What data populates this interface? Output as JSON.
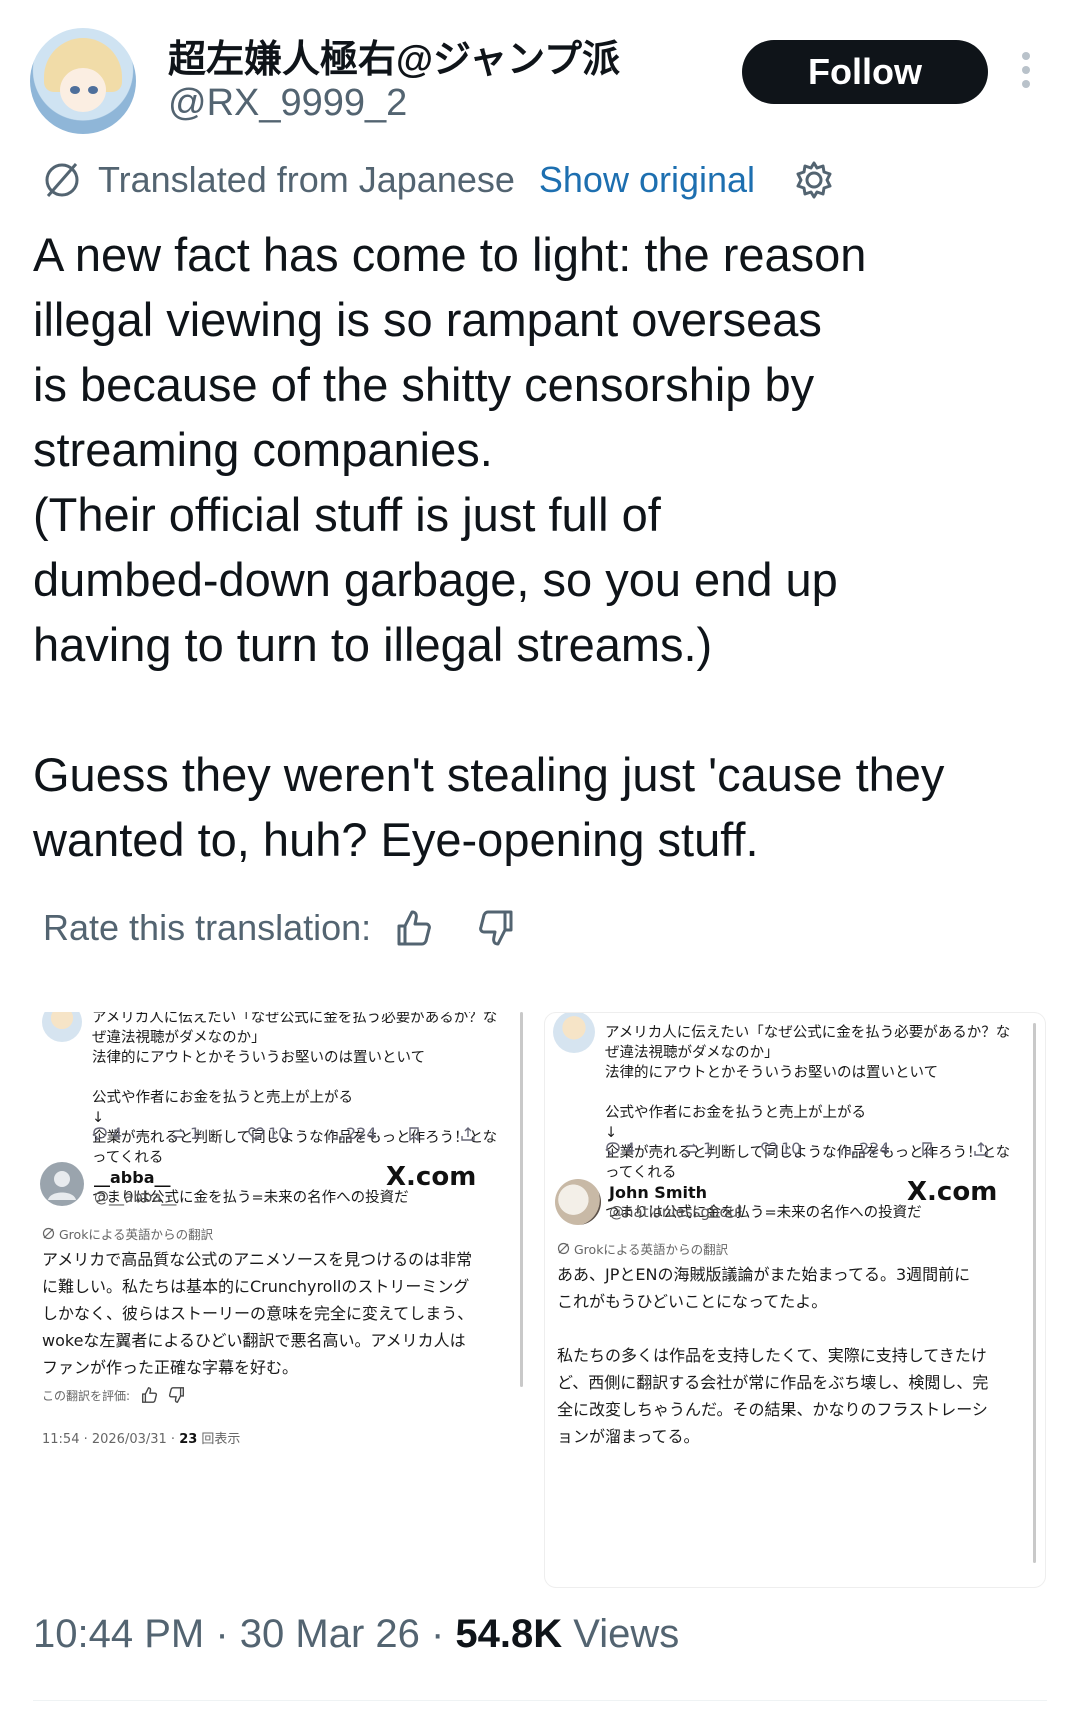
{
  "author": {
    "display_name": "超左嫌人極右@ジャンプ派",
    "handle": "@RX_9999_2",
    "follow_label": "Follow"
  },
  "translation_bar": {
    "translated_label": "Translated from Japanese",
    "show_original_label": "Show original"
  },
  "tweet": {
    "text": "A new fact has come to light: the reason\nillegal viewing is so rampant overseas\nis because of the shitty censorship by\nstreaming companies.\n(Their official stuff is just full of\ndumbed-down garbage, so you end up\nhaving to turn to illegal streams.)\n\nGuess they weren't stealing just 'cause they\nwanted to, huh? Eye-opening stuff."
  },
  "rate": {
    "label": "Rate this translation:"
  },
  "screenshots": [
    {
      "jp_text": "アメリカ人に伝えたい「なぜ公式に金を払う必要があるか？な\nぜ違法視聴がダメなのか」\n法律的にアウトとかそういうお堅いのは置いといて\n\n公式や作者にお金を払うと売上が上がる\n↓\n企業が売れると判断して同じような作品をもっと作ろう！とな\nってくれる\n\nつまりは公式に金を払う=未来の名作への投資だ",
      "stats": {
        "replies": "4",
        "reposts": "1",
        "likes": "10",
        "views": "224"
      },
      "reply_name": "__abba__",
      "reply_handle": "@__abba__",
      "source": "X.com",
      "grok_label": "Grokによる英語からの翻訳",
      "reply_text": "アメリカで高品質な公式のアニメソースを見つけるのは非常\nに難しい。私たちは基本的にCrunchyrollのストリーミング\nしかなく、彼らはストーリーの意味を完全に変えてしまう、\nwokeな左翼者によるひどい翻訳で悪名高い。アメリカ人は\nファンが作った正確な字幕を好む。",
      "rate_label": "この翻訳を評価:",
      "meta_time": "11:54 · 2026/03/31 · ",
      "meta_views": "23",
      "meta_views_label": " 回表示"
    },
    {
      "jp_text": "アメリカ人に伝えたい「なぜ公式に金を払う必要があるか？な\nぜ違法視聴がダメなのか」\n法律的にアウトとかそういうお堅いのは置いといて\n\n公式や作者にお金を払うと売上が上がる\n↓\n企業が売れると判断して同じような作品をもっと作ろう！とな\nってくれる\n\nつまりは公式に金を払う=未来の名作への投資だ",
      "stats": {
        "replies": "4",
        "reposts": "1",
        "likes": "10",
        "views": "224"
      },
      "reply_name": "John Smith",
      "reply_handle": "@nationlessghoul",
      "source": "X.com",
      "grok_label": "Grokによる英語からの翻訳",
      "reply_text": "ああ、JPとENの海賊版議論がまた始まってる。3週間前に\nこれがもうひどいことになってたよ。\n\n私たちの多くは作品を支持したくて、実際に支持してきたけ\nど、西側に翻訳する会社が常に作品をぶち壊し、検閲し、完\n全に改変しちゃうんだ。その結果、かなりのフラストレーシ\nョンが溜まってる。"
    }
  ],
  "footer": {
    "time": "10:44 PM",
    "sep1": " · ",
    "date": "30 Mar 26",
    "sep2": " · ",
    "views_count": "54.8K",
    "views_label": " Views"
  },
  "colors": {
    "text": "#0f1419",
    "secondary": "#536471",
    "link": "#1d6fb0",
    "follow_bg": "#0f1419"
  },
  "icons": [
    "globe-translate-icon",
    "gear-icon",
    "thumbs-up-icon",
    "thumbs-down-icon",
    "more-icon",
    "reply-icon",
    "repost-icon",
    "like-icon",
    "views-icon",
    "bookmark-icon",
    "share-icon"
  ]
}
